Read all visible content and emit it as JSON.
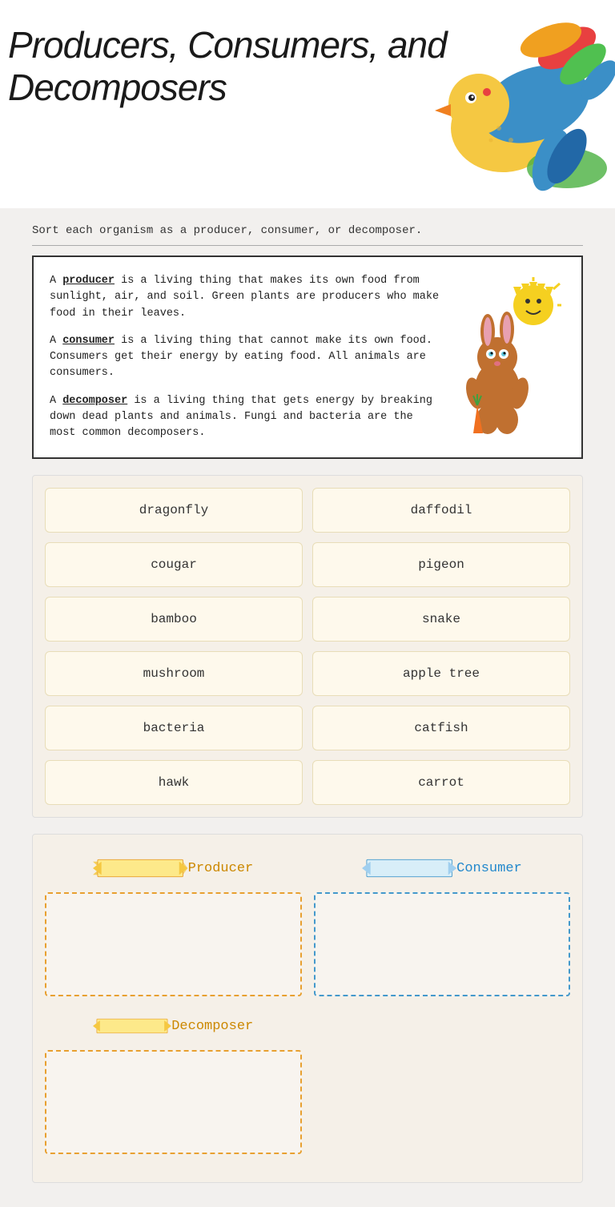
{
  "page": {
    "title_line1": "Producers, Consumers, and",
    "title_line2": "Decomposers",
    "instruction": "Sort each organism as a producer, consumer, or decomposer."
  },
  "definitions": {
    "producer": {
      "term": "producer",
      "description": "is a living thing that makes its own food from sunlight, air, and soil.  Green plants are producers who make food in their leaves."
    },
    "consumer": {
      "term": "consumer",
      "description": "is a living thing that cannot make its own food.  Consumers get their energy by eating food.  All animals are consumers."
    },
    "decomposer": {
      "term": "decomposer",
      "description": "is a living thing that gets energy by breaking down dead plants and animals.  Fungi and bacteria are the most common decomposers."
    }
  },
  "organisms": [
    {
      "id": "dragonfly",
      "label": "dragonfly"
    },
    {
      "id": "daffodil",
      "label": "daffodil"
    },
    {
      "id": "cougar",
      "label": "cougar"
    },
    {
      "id": "pigeon",
      "label": "pigeon"
    },
    {
      "id": "bamboo",
      "label": "bamboo"
    },
    {
      "id": "snake",
      "label": "snake"
    },
    {
      "id": "mushroom",
      "label": "mushroom"
    },
    {
      "id": "apple-tree",
      "label": "apple tree"
    },
    {
      "id": "bacteria",
      "label": "bacteria"
    },
    {
      "id": "catfish",
      "label": "catfish"
    },
    {
      "id": "hawk",
      "label": "hawk"
    },
    {
      "id": "carrot",
      "label": "carrot"
    }
  ],
  "sort_labels": {
    "producer": "Producer",
    "consumer": "Consumer",
    "decomposer": "Decomposer"
  },
  "colors": {
    "producer_accent": "#cc8800",
    "consumer_accent": "#2288cc",
    "decomposer_accent": "#cc8800",
    "card_bg": "#fef9ec",
    "card_border": "#e8ddb8",
    "background_brown": "#b5833a"
  }
}
